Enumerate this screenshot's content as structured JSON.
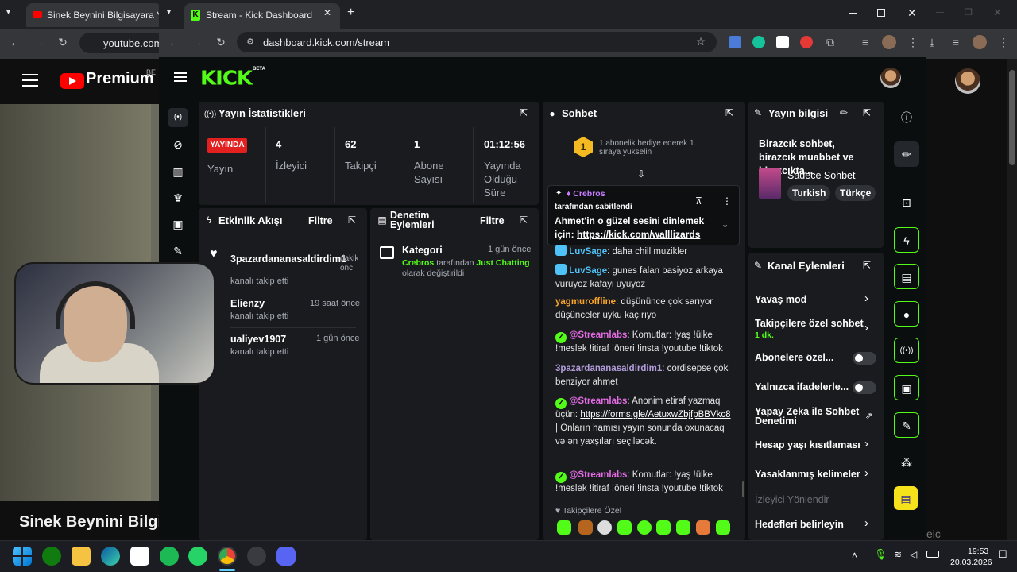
{
  "background_browser": {
    "tab_title": "Sinek Beynini Bilgisayara Yükle",
    "url": "youtube.com",
    "logo_text": "Premium",
    "beta_text": "BE",
    "video_title": "Sinek Beynini Bilgis",
    "right_text": "eic"
  },
  "browser": {
    "tab_title": "Stream - Kick Dashboard",
    "url": "dashboard.kick.com/stream",
    "new_tab": "+"
  },
  "kick": {
    "logo": "KICK",
    "beta": "BETA"
  },
  "stats": {
    "title": "Yayın İstatistikleri",
    "live_badge": "YAYINDA",
    "live_label": "Yayın",
    "viewers_value": "4",
    "viewers_label": "İzleyici",
    "followers_value": "62",
    "followers_label": "Takipçi",
    "subs_value": "1",
    "subs_label_1": "Abone",
    "subs_label_2": "Sayısı",
    "uptime_value": "01:12:56",
    "uptime_label_1": "Yayında",
    "uptime_label_2": "Olduğu",
    "uptime_label_3": "Süre"
  },
  "activity": {
    "title": "Etkinlik Akışı",
    "filter": "Filtre",
    "items": [
      {
        "name": "3pazardananasaldirdim1",
        "sub": "kanalı takip etti",
        "time": "dakik önc"
      },
      {
        "name": "Elienzy",
        "sub": "kanalı takip etti",
        "time": "19 saat önce"
      },
      {
        "name": "ualiyev1907",
        "sub": "kanalı takip etti",
        "time": "1 gün önce"
      }
    ]
  },
  "moderation": {
    "title_1": "Denetim",
    "title_2": "Eylemleri",
    "filter": "Filtre",
    "item_title": "Kategori",
    "item_time": "1 gün önce",
    "item_user": "Crebros",
    "item_mid": "tarafından",
    "item_category": "Just Chatting",
    "item_end": "olarak değiştirildi"
  },
  "chat": {
    "title": "Sohbet",
    "gift_rank": "1",
    "gift_text": "1 abonelik hediye ederek 1. sıraya yükselin",
    "pinned_user": "Crebros",
    "pinned_by": "tarafından sabitlendi",
    "pinned_text": "Ahmet'in o güzel sesini dinlemek için:",
    "pinned_link": "https://kick.com/walllizards",
    "messages": [
      {
        "user": "LuvSage",
        "text": ": daha chill muzikler",
        "color": "#4fc3f7"
      },
      {
        "user": "LuvSage",
        "text": ": gunes falan basiyoz arkaya vuruyoz kafayi uyuyoz",
        "color": "#4fc3f7"
      },
      {
        "user": "yagmuroffline",
        "text": ": düşününce çok sarıyor düşünceler uyku kaçırıyo",
        "color": "#ffa726"
      },
      {
        "user": "@Streamlabs",
        "text": ": Komutlar: !yaş !ülke !meslek !itiraf !öneri !insta !youtube !tiktok",
        "color": "#e66ce6"
      },
      {
        "user": "3pazardananasaldirdim1",
        "text": ": cordisepse çok benziyor ahmet",
        "color": "#b39ddb"
      },
      {
        "user": "@Streamlabs",
        "text": ": Anonim etiraf yazmaq üçün:",
        "color": "#e66ce6"
      },
      {
        "user": "@Streamlabs",
        "text": ": Komutlar: !yaş !ülke !meslek !itiraf !öneri !insta !youtube !tiktok",
        "color": "#e66ce6"
      }
    ],
    "anon_link": "https://forms.gle/AetuxwZbjfpBBVkc8",
    "anon_tail": "Onların hamısı yayın sonunda oxunacaq və ən yaxşıları seçiləcək.",
    "followers_only": "Takipçilere Özel"
  },
  "stream_info": {
    "title": "Yayın bilgisi",
    "stream_title": "Birazcık sohbet, birazcık muabbet ve birazcıkta...",
    "category": "Sadece Sohbet",
    "tag1": "Turkish",
    "tag2": "Türkçe"
  },
  "channel_actions": {
    "title": "Kanal Eylemleri",
    "slow_mode": "Yavaş mod",
    "followers_chat": "Takipçilere özel sohbet",
    "followers_chat_value": "1 dk.",
    "subs_only": "Abonelere özel...",
    "emotes_only": "Yalnızca ifadelerle...",
    "ai_mod_1": "Yapay Zeka ile Sohbet",
    "ai_mod_2": "Denetimi",
    "age": "Hesap yaşı kısıtlaması",
    "banned": "Yasaklanmış kelimeler",
    "redirect": "İzleyici Yönlendir",
    "goals": "Hedefleri belirleyin"
  },
  "taskbar": {
    "time": "19:53",
    "date": "20.03.2026"
  }
}
